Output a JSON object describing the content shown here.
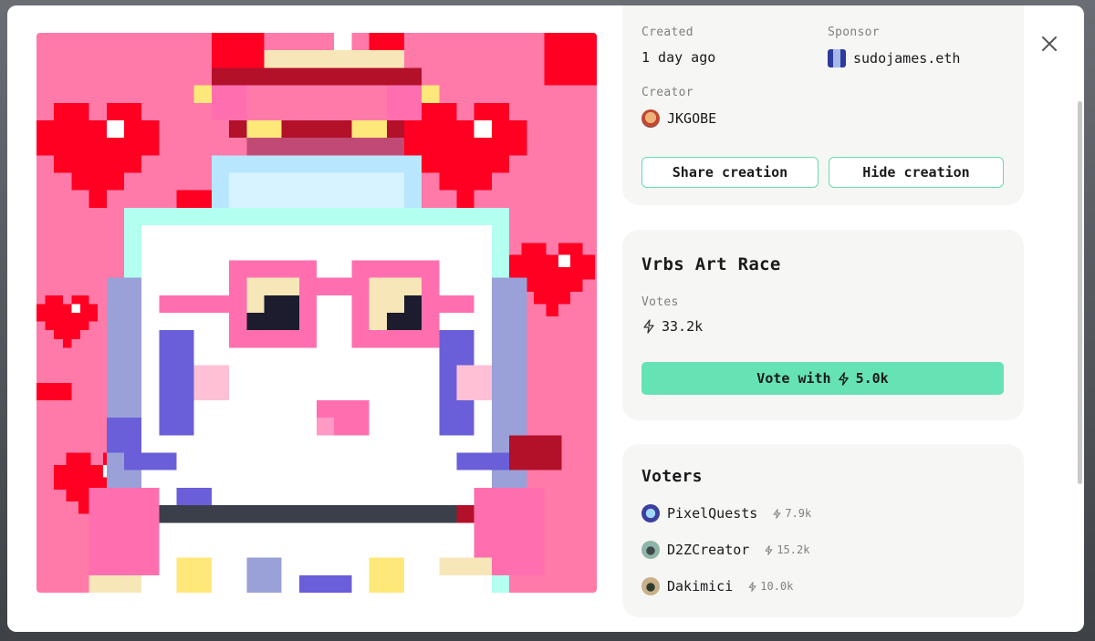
{
  "meta": {
    "created_label": "Created",
    "created_value": "1 day ago",
    "sponsor_label": "Sponsor",
    "sponsor_value": "sudojames.eth",
    "creator_label": "Creator",
    "creator_value": "JKGOBE"
  },
  "actions": {
    "share_label": "Share creation",
    "hide_label": "Hide creation"
  },
  "race": {
    "title": "Vrbs Art Race",
    "votes_label": "Votes",
    "votes_value": "33.2k",
    "vote_button_prefix": "Vote with",
    "vote_button_amount": "5.0k"
  },
  "voters": {
    "title": "Voters",
    "items": [
      {
        "name": "PixelQuests",
        "amount": "7.9k",
        "avatar_color": "#3b3f9e"
      },
      {
        "name": "D2ZCreator",
        "amount": "15.2k",
        "avatar_color": "#6f9c8f"
      },
      {
        "name": "Dakimici",
        "amount": "10.0k",
        "avatar_color": "#c9b089"
      }
    ]
  },
  "colors": {
    "accent": "#66e3b4",
    "accent_border": "#66dcb0",
    "art_bg": "#ff7aa8",
    "heart": "#ff0022"
  },
  "icons": {
    "close": "close-icon",
    "bolt": "bolt-icon"
  }
}
